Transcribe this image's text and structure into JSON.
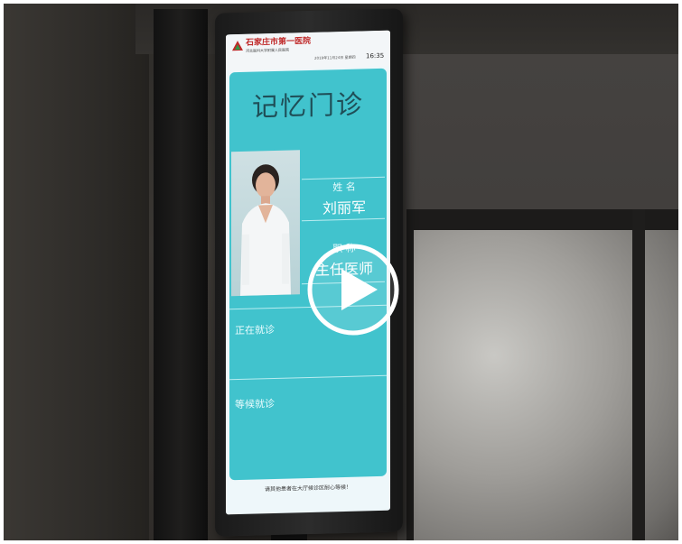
{
  "hospital": {
    "name": "石家庄市第一医院",
    "sub_name": "河北医科大学附属人民医院",
    "date": "2019年11月24日 星期四",
    "time": "16:35",
    "brand_color": "#c02a2a"
  },
  "clinic": {
    "title": "记忆门诊",
    "name_label": "姓 名",
    "doctor_name": "刘丽军",
    "position_label": "职 称",
    "position": "主任医师",
    "now_label": "正在就诊",
    "waiting_label": "等候就诊",
    "footer": "请其他患者在大厅候诊区耐心等候！",
    "panel_color": "#41c3cd"
  },
  "video": {
    "play_icon": "play-icon"
  }
}
